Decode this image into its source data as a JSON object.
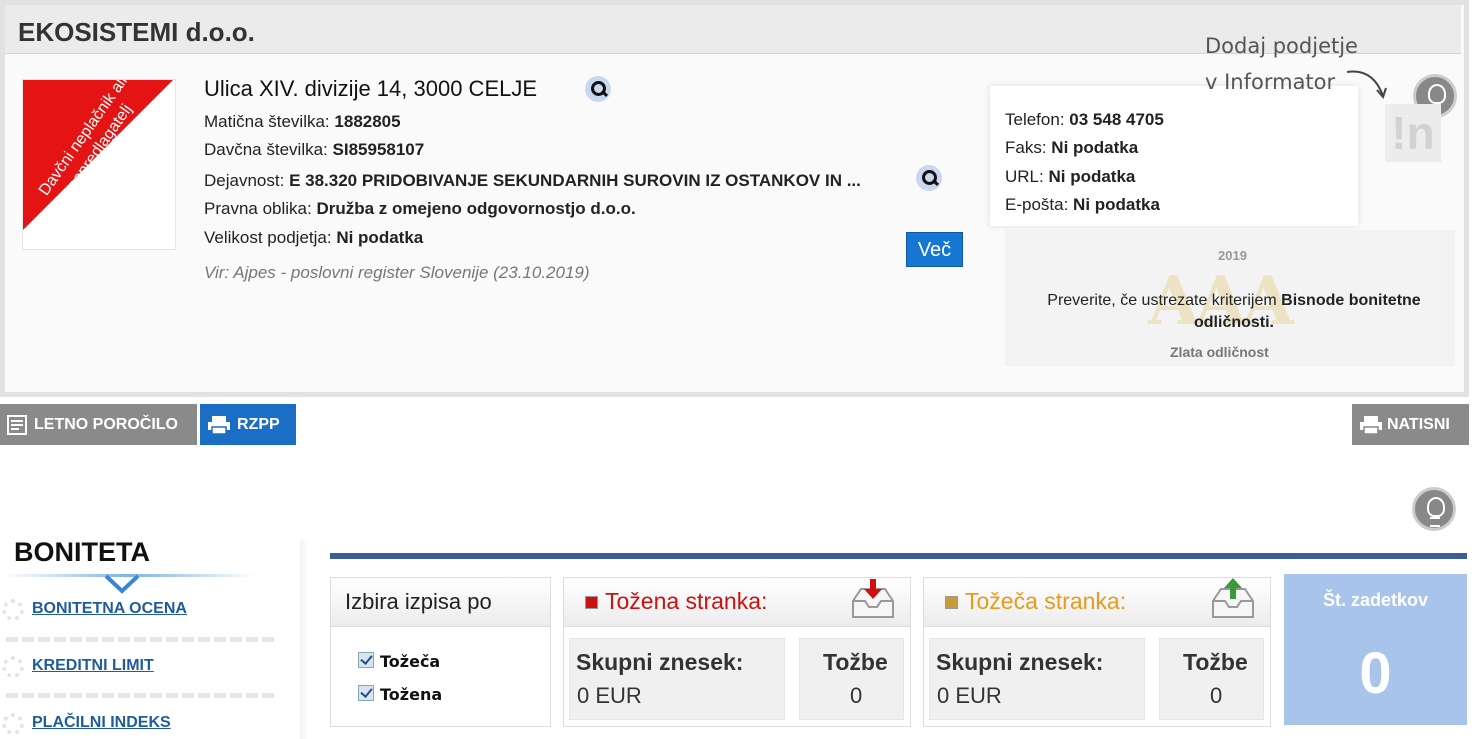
{
  "company": {
    "name": "EKOSISTEMI d.o.o.",
    "ribbon": "Davčni neplačnik ali nepredlagatelj",
    "address": "Ulica XIV. divizije 14, 3000 CELJE",
    "maticna_label": "Matična številka:",
    "maticna_value": "1882805",
    "davcna_label": "Davčna številka:",
    "davcna_value": "SI85958107",
    "dejavnost_label": "Dejavnost:",
    "dejavnost_value": "E 38.320 PRIDOBIVANJE SEKUNDARNIH SUROVIN IZ OSTANKOV IN ...",
    "pravna_label": "Pravna oblika:",
    "pravna_value": "Družba z omejeno odgovornostjo d.o.o.",
    "velikost_label": "Velikost podjetja:",
    "velikost_value": "Ni podatka",
    "source": "Vir: Ajpes - poslovni register Slovenije (23.10.2019)",
    "more_button": "Več"
  },
  "contact": {
    "telefon_label": "Telefon:",
    "telefon_value": "03 548 4705",
    "faks_label": "Faks:",
    "faks_value": "Ni podatka",
    "url_label": "URL:",
    "url_value": "Ni podatka",
    "eposta_label": "E-pošta:",
    "eposta_value": "Ni podatka"
  },
  "informator": {
    "line1": "Dodaj podjetje",
    "line2": "v Informator",
    "logo": "!n"
  },
  "aaa": {
    "year": "2019",
    "big": "AAA",
    "text_normal": "Preverite, če ustrezate kriterijem ",
    "text_bold": "Bisnode bonitetne odličnosti.",
    "sub": "Zlata odličnost"
  },
  "tabs": {
    "letno": "LETNO POROČILO",
    "rzpp": "RZPP",
    "natisni": "NATISNI"
  },
  "sidebar": {
    "title": "BONITETA",
    "items": [
      {
        "label": "BONITETNA OCENA"
      },
      {
        "label": "KREDITNI LIMIT"
      },
      {
        "label": "PLAČILNI INDEKS"
      }
    ]
  },
  "izbira": {
    "title": "Izbira izpisa po",
    "options": [
      {
        "label": "Tožeča",
        "checked": true
      },
      {
        "label": "Tožena",
        "checked": true
      }
    ]
  },
  "tozena": {
    "title": "Tožena stranka:",
    "color": "#cc1111",
    "skupni_label": "Skupni znesek:",
    "skupni_value": "0 EUR",
    "tozbe_label": "Tožbe",
    "tozbe_value": "0"
  },
  "tozeca": {
    "title": "Tožeča stranka:",
    "color": "#e89a1a",
    "skupni_label": "Skupni znesek:",
    "skupni_value": "0 EUR",
    "tozbe_label": "Tožbe",
    "tozbe_value": "0"
  },
  "zadetki": {
    "label": "Št. zadetkov",
    "value": "0"
  }
}
